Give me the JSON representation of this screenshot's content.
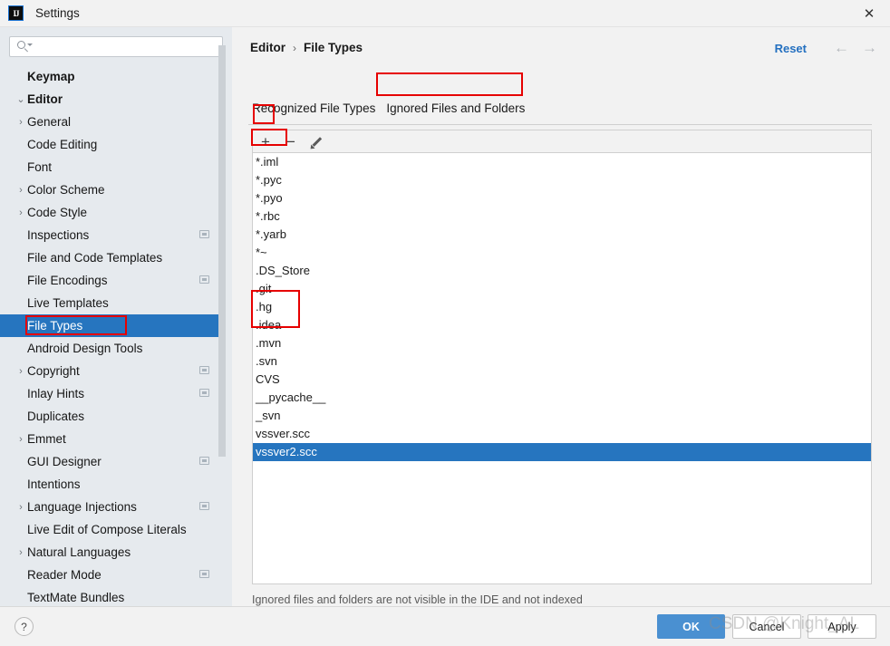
{
  "window": {
    "title": "Settings",
    "logo_text": "IJ",
    "close_label": "✕"
  },
  "sidebar": {
    "search": {
      "value": "",
      "placeholder": ""
    },
    "items": [
      {
        "label": "Keymap",
        "depth": 0,
        "chevron": "",
        "bold": true,
        "badge": false,
        "selected": false
      },
      {
        "label": "Editor",
        "depth": 0,
        "chevron": "⌄",
        "bold": true,
        "badge": false,
        "selected": false
      },
      {
        "label": "General",
        "depth": 1,
        "chevron": "›",
        "bold": false,
        "badge": false,
        "selected": false
      },
      {
        "label": "Code Editing",
        "depth": 1,
        "chevron": "",
        "bold": false,
        "badge": false,
        "selected": false
      },
      {
        "label": "Font",
        "depth": 1,
        "chevron": "",
        "bold": false,
        "badge": false,
        "selected": false
      },
      {
        "label": "Color Scheme",
        "depth": 1,
        "chevron": "›",
        "bold": false,
        "badge": false,
        "selected": false
      },
      {
        "label": "Code Style",
        "depth": 1,
        "chevron": "›",
        "bold": false,
        "badge": false,
        "selected": false
      },
      {
        "label": "Inspections",
        "depth": 1,
        "chevron": "",
        "bold": false,
        "badge": true,
        "selected": false
      },
      {
        "label": "File and Code Templates",
        "depth": 1,
        "chevron": "",
        "bold": false,
        "badge": false,
        "selected": false
      },
      {
        "label": "File Encodings",
        "depth": 1,
        "chevron": "",
        "bold": false,
        "badge": true,
        "selected": false
      },
      {
        "label": "Live Templates",
        "depth": 1,
        "chevron": "",
        "bold": false,
        "badge": false,
        "selected": false
      },
      {
        "label": "File Types",
        "depth": 1,
        "chevron": "",
        "bold": false,
        "badge": false,
        "selected": true
      },
      {
        "label": "Android Design Tools",
        "depth": 1,
        "chevron": "",
        "bold": false,
        "badge": false,
        "selected": false
      },
      {
        "label": "Copyright",
        "depth": 1,
        "chevron": "›",
        "bold": false,
        "badge": true,
        "selected": false
      },
      {
        "label": "Inlay Hints",
        "depth": 1,
        "chevron": "",
        "bold": false,
        "badge": true,
        "selected": false
      },
      {
        "label": "Duplicates",
        "depth": 1,
        "chevron": "",
        "bold": false,
        "badge": false,
        "selected": false
      },
      {
        "label": "Emmet",
        "depth": 1,
        "chevron": "›",
        "bold": false,
        "badge": false,
        "selected": false
      },
      {
        "label": "GUI Designer",
        "depth": 1,
        "chevron": "",
        "bold": false,
        "badge": true,
        "selected": false
      },
      {
        "label": "Intentions",
        "depth": 1,
        "chevron": "",
        "bold": false,
        "badge": false,
        "selected": false
      },
      {
        "label": "Language Injections",
        "depth": 1,
        "chevron": "›",
        "bold": false,
        "badge": true,
        "selected": false
      },
      {
        "label": "Live Edit of Compose Literals",
        "depth": 1,
        "chevron": "",
        "bold": false,
        "badge": false,
        "selected": false
      },
      {
        "label": "Natural Languages",
        "depth": 1,
        "chevron": "›",
        "bold": false,
        "badge": false,
        "selected": false
      },
      {
        "label": "Reader Mode",
        "depth": 1,
        "chevron": "",
        "bold": false,
        "badge": true,
        "selected": false
      },
      {
        "label": "TextMate Bundles",
        "depth": 1,
        "chevron": "",
        "bold": false,
        "badge": false,
        "selected": false
      }
    ]
  },
  "main": {
    "breadcrumb": {
      "root": "Editor",
      "separator": "›",
      "current": "File Types"
    },
    "reset_label": "Reset",
    "nav": {
      "back": "←",
      "forward": "→"
    },
    "tabs": [
      {
        "label": "Recognized File Types",
        "active": false
      },
      {
        "label": "Ignored Files and Folders",
        "active": true
      }
    ],
    "toolbar": {
      "add_label": "+",
      "remove_label": "−",
      "edit_icon": "pencil-icon"
    },
    "list": [
      {
        "label": "*.iml",
        "selected": false
      },
      {
        "label": "*.pyc",
        "selected": false
      },
      {
        "label": "*.pyo",
        "selected": false
      },
      {
        "label": "*.rbc",
        "selected": false
      },
      {
        "label": "*.yarb",
        "selected": false
      },
      {
        "label": "*~",
        "selected": false
      },
      {
        "label": ".DS_Store",
        "selected": false
      },
      {
        "label": ".git",
        "selected": false
      },
      {
        "label": ".hg",
        "selected": false
      },
      {
        "label": ".idea",
        "selected": false
      },
      {
        "label": ".mvn",
        "selected": false
      },
      {
        "label": ".svn",
        "selected": false
      },
      {
        "label": "CVS",
        "selected": false
      },
      {
        "label": "__pycache__",
        "selected": false
      },
      {
        "label": "_svn",
        "selected": false
      },
      {
        "label": "vssver.scc",
        "selected": false
      },
      {
        "label": "vssver2.scc",
        "selected": true
      }
    ],
    "hint": "Ignored files and folders are not visible in the IDE and not indexed"
  },
  "footer": {
    "help_label": "?",
    "ok_label": "OK",
    "cancel_label": "Cancel",
    "apply_label": "Apply"
  },
  "watermark": {
    "text": "CSDN @Knight_AL"
  },
  "annotations": {
    "accent_red": "#e60000",
    "selection_blue": "#2675bf",
    "link_blue": "#2470c0"
  }
}
